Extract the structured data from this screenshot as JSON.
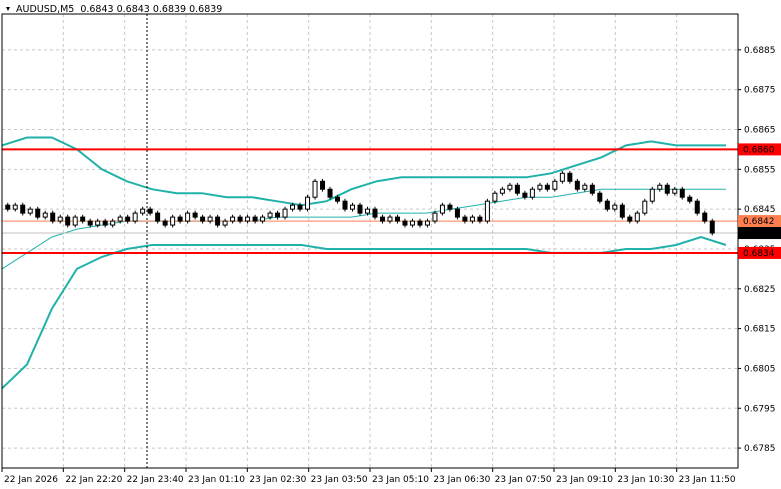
{
  "header": {
    "symbol": "AUDUSD,M5",
    "ohlc": "0.6843 0.6843 0.6839 0.6839"
  },
  "colors": {
    "background": "#ffffff",
    "grid": "#c8c8c8",
    "candle": "#000000",
    "bollinger": "#20b2aa",
    "level_line": "#ff0000",
    "current_line": "#ff7f50",
    "crosshair": "#000000"
  },
  "chart_data": {
    "type": "candlestick",
    "ylim": [
      0.678,
      0.6894
    ],
    "y_ticks": [
      "0.6885",
      "0.6875",
      "0.6865",
      "0.6855",
      "0.6845",
      "0.6835",
      "0.6825",
      "0.6815",
      "0.6805",
      "0.6795",
      "0.6785"
    ],
    "x_ticks": [
      "22 Jan 2026",
      "22 Jan 22:20",
      "22 Jan 23:40",
      "23 Jan 01:10",
      "23 Jan 02:30",
      "23 Jan 03:50",
      "23 Jan 05:10",
      "23 Jan 06:30",
      "23 Jan 07:50",
      "23 Jan 09:10",
      "23 Jan 10:30",
      "23 Jan 11:50"
    ],
    "levels": [
      {
        "value": 0.686,
        "label": "0.6860",
        "kind": "resistance"
      },
      {
        "value": 0.6834,
        "label": "0.6834",
        "kind": "support"
      }
    ],
    "current_level": {
      "value": 0.6842,
      "label": "0.6842"
    },
    "bid": {
      "value": 0.6839,
      "label": "0.6839"
    },
    "bollinger_upper": [
      0.6861,
      0.6863,
      0.6863,
      0.686,
      0.6855,
      0.6852,
      0.685,
      0.6849,
      0.6849,
      0.6848,
      0.6848,
      0.6847,
      0.6846,
      0.6847,
      0.685,
      0.6852,
      0.6853,
      0.6853,
      0.6853,
      0.6853,
      0.6853,
      0.6853,
      0.6854,
      0.6856,
      0.6858,
      0.6861,
      0.6862,
      0.6861,
      0.6861,
      0.6861
    ],
    "bollinger_mid": [
      0.683,
      0.6834,
      0.6838,
      0.684,
      0.6841,
      0.6842,
      0.6842,
      0.6842,
      0.6842,
      0.6842,
      0.6842,
      0.6843,
      0.6843,
      0.6843,
      0.6843,
      0.6844,
      0.6844,
      0.6844,
      0.6845,
      0.6846,
      0.6847,
      0.6848,
      0.6848,
      0.6849,
      0.685,
      0.685,
      0.685,
      0.685,
      0.685,
      0.685
    ],
    "bollinger_lower": [
      0.68,
      0.6806,
      0.682,
      0.683,
      0.6833,
      0.6835,
      0.6836,
      0.6836,
      0.6836,
      0.6836,
      0.6836,
      0.6836,
      0.6836,
      0.6835,
      0.6835,
      0.6835,
      0.6835,
      0.6835,
      0.6835,
      0.6835,
      0.6835,
      0.6835,
      0.6834,
      0.6834,
      0.6834,
      0.6835,
      0.6835,
      0.6836,
      0.6838,
      0.6836
    ],
    "candles": [
      [
        0.6846,
        0.6845
      ],
      [
        0.6845,
        0.6846
      ],
      [
        0.6846,
        0.6844
      ],
      [
        0.6844,
        0.6845
      ],
      [
        0.6845,
        0.6843
      ],
      [
        0.6843,
        0.6844
      ],
      [
        0.6844,
        0.6842
      ],
      [
        0.6842,
        0.6843
      ],
      [
        0.6843,
        0.6841
      ],
      [
        0.6841,
        0.6843
      ],
      [
        0.6843,
        0.6842
      ],
      [
        0.6842,
        0.6841
      ],
      [
        0.6841,
        0.6842
      ],
      [
        0.6842,
        0.6841
      ],
      [
        0.6841,
        0.6842
      ],
      [
        0.6842,
        0.6843
      ],
      [
        0.6843,
        0.6842
      ],
      [
        0.6842,
        0.6844
      ],
      [
        0.6844,
        0.6845
      ],
      [
        0.6845,
        0.6844
      ],
      [
        0.6844,
        0.6842
      ],
      [
        0.6842,
        0.6841
      ],
      [
        0.6841,
        0.6843
      ],
      [
        0.6843,
        0.6842
      ],
      [
        0.6842,
        0.6844
      ],
      [
        0.6844,
        0.6843
      ],
      [
        0.6843,
        0.6842
      ],
      [
        0.6842,
        0.6843
      ],
      [
        0.6843,
        0.6841
      ],
      [
        0.6841,
        0.6842
      ],
      [
        0.6842,
        0.6843
      ],
      [
        0.6843,
        0.6842
      ],
      [
        0.6842,
        0.6843
      ],
      [
        0.6843,
        0.6842
      ],
      [
        0.6842,
        0.6843
      ],
      [
        0.6843,
        0.6844
      ],
      [
        0.6844,
        0.6843
      ],
      [
        0.6843,
        0.6845
      ],
      [
        0.6845,
        0.6846
      ],
      [
        0.6846,
        0.6845
      ],
      [
        0.6845,
        0.6848
      ],
      [
        0.6848,
        0.6852
      ],
      [
        0.6852,
        0.685
      ],
      [
        0.685,
        0.6848
      ],
      [
        0.6848,
        0.6847
      ],
      [
        0.6847,
        0.6845
      ],
      [
        0.6845,
        0.6846
      ],
      [
        0.6846,
        0.6844
      ],
      [
        0.6844,
        0.6845
      ],
      [
        0.6845,
        0.6843
      ],
      [
        0.6843,
        0.6842
      ],
      [
        0.6842,
        0.6843
      ],
      [
        0.6843,
        0.6842
      ],
      [
        0.6842,
        0.6841
      ],
      [
        0.6841,
        0.6842
      ],
      [
        0.6842,
        0.6841
      ],
      [
        0.6841,
        0.6842
      ],
      [
        0.6842,
        0.6844
      ],
      [
        0.6844,
        0.6846
      ],
      [
        0.6846,
        0.6845
      ],
      [
        0.6845,
        0.6843
      ],
      [
        0.6843,
        0.6842
      ],
      [
        0.6842,
        0.6843
      ],
      [
        0.6843,
        0.6842
      ],
      [
        0.6842,
        0.6847
      ],
      [
        0.6847,
        0.6849
      ],
      [
        0.6849,
        0.685
      ],
      [
        0.685,
        0.6851
      ],
      [
        0.6851,
        0.6849
      ],
      [
        0.6849,
        0.6848
      ],
      [
        0.6848,
        0.685
      ],
      [
        0.685,
        0.6851
      ],
      [
        0.6851,
        0.685
      ],
      [
        0.685,
        0.6852
      ],
      [
        0.6852,
        0.6854
      ],
      [
        0.6854,
        0.6852
      ],
      [
        0.6852,
        0.685
      ],
      [
        0.685,
        0.6851
      ],
      [
        0.6851,
        0.6849
      ],
      [
        0.6849,
        0.6847
      ],
      [
        0.6847,
        0.6845
      ],
      [
        0.6845,
        0.6846
      ],
      [
        0.6846,
        0.6843
      ],
      [
        0.6843,
        0.6842
      ],
      [
        0.6842,
        0.6844
      ],
      [
        0.6844,
        0.6847
      ],
      [
        0.6847,
        0.685
      ],
      [
        0.685,
        0.6851
      ],
      [
        0.6851,
        0.6849
      ],
      [
        0.6849,
        0.685
      ],
      [
        0.685,
        0.6848
      ],
      [
        0.6848,
        0.6847
      ],
      [
        0.6847,
        0.6844
      ],
      [
        0.6844,
        0.6842
      ],
      [
        0.6842,
        0.6839
      ]
    ]
  }
}
